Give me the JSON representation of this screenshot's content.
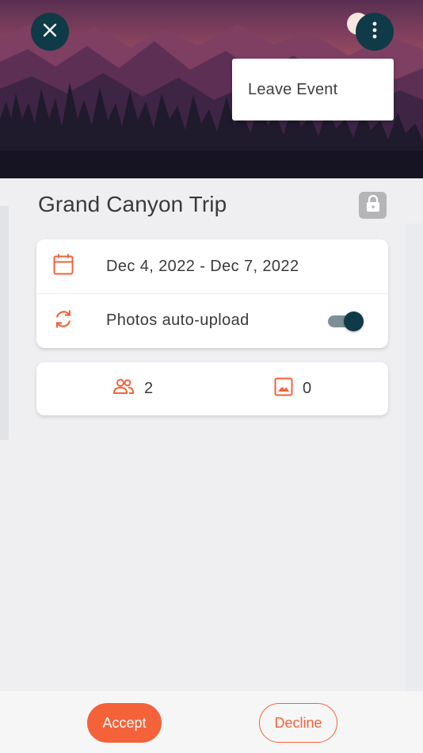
{
  "header": {
    "close_icon": "close-icon",
    "more_icon": "more-vertical-icon"
  },
  "menu": {
    "items": [
      {
        "label": "Leave Event"
      }
    ]
  },
  "event": {
    "title": "Grand Canyon Trip",
    "lock_icon": "lock-icon",
    "date_range": "Dec 4, 2022 - Dec 7, 2022",
    "auto_upload_label": "Photos auto-upload",
    "auto_upload_enabled": true
  },
  "stats": {
    "members_icon": "people-icon",
    "members_count": "2",
    "photos_icon": "image-icon",
    "photos_count": "0"
  },
  "actions": {
    "accept_label": "Accept",
    "decline_label": "Decline"
  },
  "colors": {
    "accent": "#f4623a",
    "dark_teal": "#0f3a47",
    "background": "#efeff1"
  }
}
